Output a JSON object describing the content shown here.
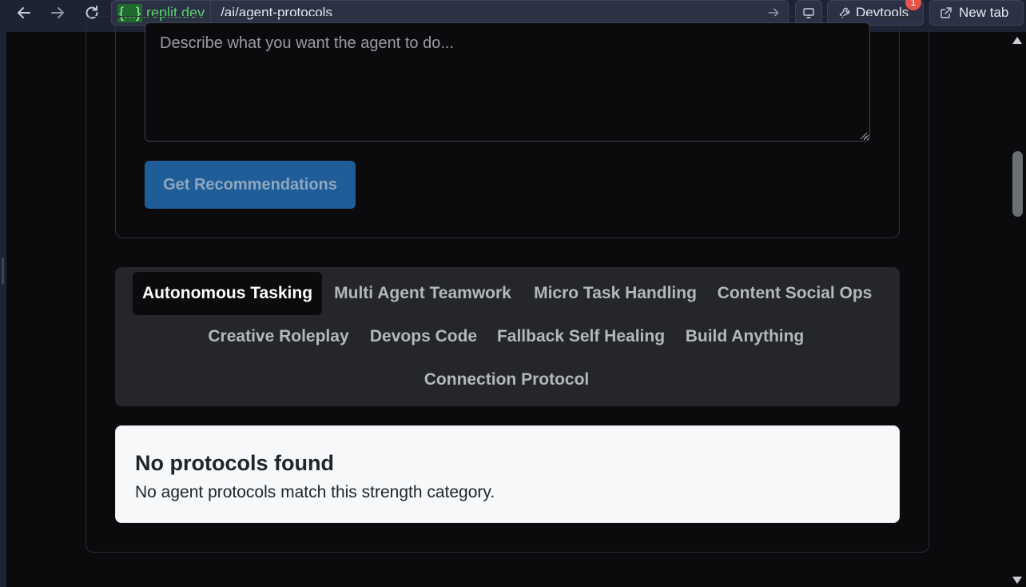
{
  "browser": {
    "url_host_braces": "{...}",
    "url_host_domain": ".replit.dev",
    "url_path": "/ai/agent-protocols",
    "devtools_label": "Devtools",
    "devtools_badge": "1",
    "new_tab_label": "New tab"
  },
  "recommend": {
    "placeholder": "Describe what you want the agent to do...",
    "button_label": "Get Recommendations",
    "button_color": "#1f5d98"
  },
  "tabs": [
    {
      "label": "Autonomous Tasking",
      "active": true
    },
    {
      "label": "Multi Agent Teamwork",
      "active": false
    },
    {
      "label": "Micro Task Handling",
      "active": false
    },
    {
      "label": "Content Social Ops",
      "active": false
    },
    {
      "label": "Creative Roleplay",
      "active": false
    },
    {
      "label": "Devops Code",
      "active": false
    },
    {
      "label": "Fallback Self Healing",
      "active": false
    },
    {
      "label": "Build Anything",
      "active": false
    },
    {
      "label": "Connection Protocol",
      "active": false
    }
  ],
  "empty_state": {
    "title": "No protocols found",
    "description": "No agent protocols match this strength category."
  },
  "icons": {
    "back": "arrow-left-icon",
    "forward": "arrow-right-icon",
    "reload": "reload-icon",
    "go": "arrow-right-icon",
    "screen": "monitor-icon",
    "devtools": "wrench-icon",
    "new_tab": "external-link-icon"
  }
}
